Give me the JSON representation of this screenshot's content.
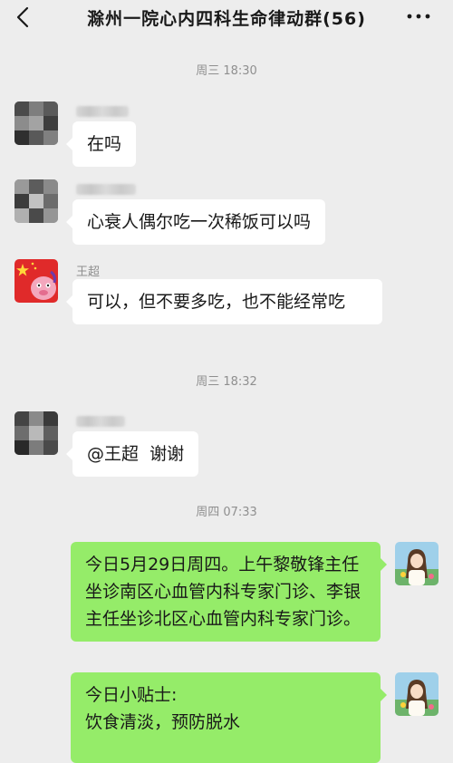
{
  "header": {
    "title": "滁州一院心内四科生命律动群(56)",
    "back_icon": "chevron-left-icon",
    "more_icon": "more-dots-icon"
  },
  "timestamps": [
    "周三 18:30",
    "周三 18:32",
    "周四 07:33"
  ],
  "messages": [
    {
      "sender": "",
      "text": "在吗",
      "direction": "in"
    },
    {
      "sender": "",
      "text": "心衰人偶尔吃一次稀饭可以吗",
      "direction": "in"
    },
    {
      "sender": "王超",
      "text": "可以，但不要多吃，也不能经常吃",
      "direction": "in"
    },
    {
      "sender": "",
      "text": "@王超  谢谢",
      "direction": "in"
    },
    {
      "sender": "",
      "text": "今日5月29日周四。上午黎敬锋主任坐诊南区心血管内科专家门诊、李银主任坐诊北区心血管内科专家门诊。",
      "direction": "out"
    },
    {
      "sender": "",
      "text": "今日小贴士:\n饮食清淡，预防脱水",
      "direction": "out"
    }
  ],
  "colors": {
    "background": "#ededed",
    "incoming_bubble": "#ffffff",
    "outgoing_bubble": "#95ec69",
    "meta_text": "#8f8f8f"
  }
}
